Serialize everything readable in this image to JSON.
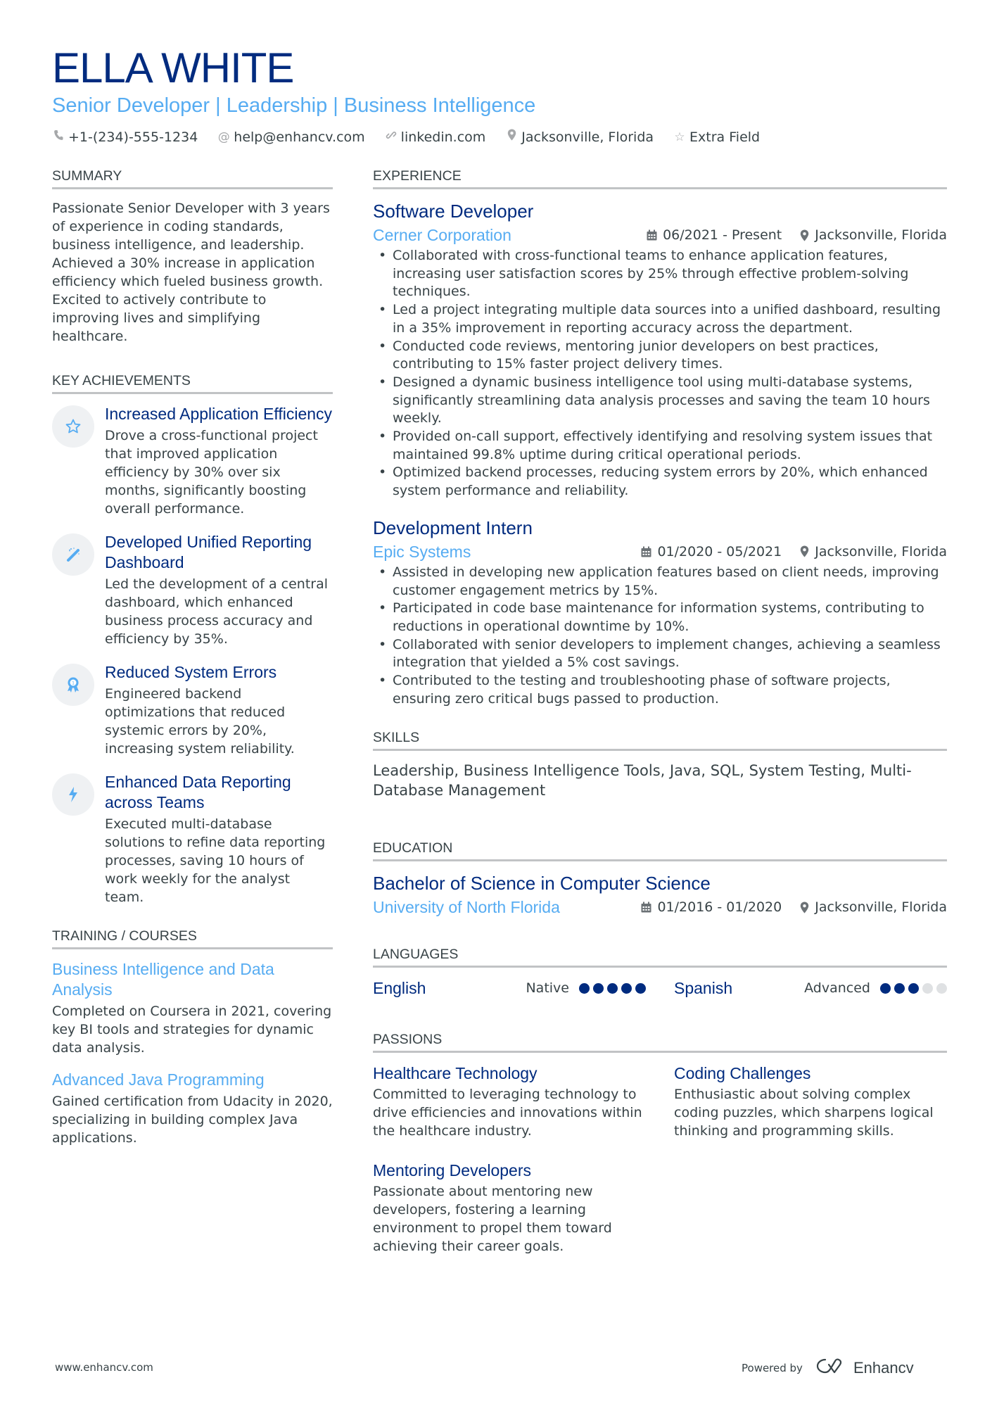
{
  "header": {
    "name": "ELLA WHITE",
    "subtitle": "Senior Developer | Leadership | Business Intelligence",
    "contacts": [
      {
        "icon": "phone-icon",
        "text": "+1-(234)-555-1234"
      },
      {
        "icon": "at-icon",
        "text": "help@enhancv.com"
      },
      {
        "icon": "link-icon",
        "text": "linkedin.com"
      },
      {
        "icon": "location-icon",
        "text": "Jacksonville, Florida"
      },
      {
        "icon": "star-icon",
        "text": "Extra Field"
      }
    ]
  },
  "colors": {
    "name": "#002b7f",
    "accent": "#56acf2",
    "text": "#384347",
    "divider": "#c1c3c5"
  },
  "summary": {
    "title": "SUMMARY",
    "text": "Passionate Senior Developer with 3 years of experience in coding standards, business intelligence, and leadership. Achieved a 30% increase in application efficiency which fueled business growth. Excited to actively contribute to improving lives and simplifying healthcare."
  },
  "achievements": {
    "title": "KEY ACHIEVEMENTS",
    "items": [
      {
        "icon": "star-icon",
        "title": "Increased Application Efficiency",
        "text": "Drove a cross-functional project that improved application efficiency by 30% over six months, significantly boosting overall performance."
      },
      {
        "icon": "magic-wand-icon",
        "title": "Developed Unified Reporting Dashboard",
        "text": "Led the development of a central dashboard, which enhanced business process accuracy and efficiency by 35%."
      },
      {
        "icon": "award-ribbon-icon",
        "title": "Reduced System Errors",
        "text": "Engineered backend optimizations that reduced systemic errors by 20%, increasing system reliability."
      },
      {
        "icon": "lightning-icon",
        "title": "Enhanced Data Reporting across Teams",
        "text": "Executed multi-database solutions to refine data reporting processes, saving 10 hours of work weekly for the analyst team."
      }
    ]
  },
  "training": {
    "title": "TRAINING / COURSES",
    "items": [
      {
        "title": "Business Intelligence and Data Analysis",
        "text": "Completed on Coursera in 2021, covering key BI tools and strategies for dynamic data analysis."
      },
      {
        "title": "Advanced Java Programming",
        "text": "Gained certification from Udacity in 2020, specializing in building complex Java applications."
      }
    ]
  },
  "experience": {
    "title": "EXPERIENCE",
    "jobs": [
      {
        "role": "Software Developer",
        "company": "Cerner Corporation",
        "dates": "06/2021 - Present",
        "location": "Jacksonville, Florida",
        "bullets": [
          "Collaborated with cross-functional teams to enhance application features, increasing user satisfaction scores by 25% through effective problem-solving techniques.",
          "Led a project integrating multiple data sources into a unified dashboard, resulting in a 35% improvement in reporting accuracy across the department.",
          "Conducted code reviews, mentoring junior developers on best practices, contributing to 15% faster project delivery times.",
          "Designed a dynamic business intelligence tool using multi-database systems, significantly streamlining data analysis processes and saving the team 10 hours weekly.",
          "Provided on-call support, effectively identifying and resolving system issues that maintained 99.8% uptime during critical operational periods.",
          "Optimized backend processes, reducing system errors by 20%, which enhanced system performance and reliability."
        ]
      },
      {
        "role": "Development Intern",
        "company": "Epic Systems",
        "dates": "01/2020 - 05/2021",
        "location": "Jacksonville, Florida",
        "bullets": [
          "Assisted in developing new application features based on client needs, improving customer engagement metrics by 15%.",
          "Participated in code base maintenance for information systems, contributing to reductions in operational downtime by 10%.",
          "Collaborated with senior developers to implement changes, achieving a seamless integration that yielded a 5% cost savings.",
          "Contributed to the testing and troubleshooting phase of software projects, ensuring zero critical bugs passed to production."
        ]
      }
    ]
  },
  "skills": {
    "title": "SKILLS",
    "text": "Leadership, Business Intelligence Tools, Java, SQL, System Testing, Multi-Database Management"
  },
  "education": {
    "title": "EDUCATION",
    "degree": "Bachelor of Science in Computer Science",
    "school": "University of North Florida",
    "dates": "01/2016 - 01/2020",
    "location": "Jacksonville, Florida"
  },
  "languages": {
    "title": "LANGUAGES",
    "items": [
      {
        "name": "English",
        "level": "Native",
        "rating": 5,
        "max": 5
      },
      {
        "name": "Spanish",
        "level": "Advanced",
        "rating": 3,
        "max": 5
      }
    ]
  },
  "passions": {
    "title": "PASSIONS",
    "items": [
      {
        "title": "Healthcare Technology",
        "text": "Committed to leveraging technology to drive efficiencies and innovations within the healthcare industry."
      },
      {
        "title": "Coding Challenges",
        "text": "Enthusiastic about solving complex coding puzzles, which sharpens logical thinking and programming skills."
      },
      {
        "title": "Mentoring Developers",
        "text": "Passionate about mentoring new developers, fostering a learning environment to propel them toward achieving their career goals."
      }
    ]
  },
  "footer": {
    "website": "www.enhancv.com",
    "powered_by": "Powered by",
    "brand": "Enhancv"
  }
}
